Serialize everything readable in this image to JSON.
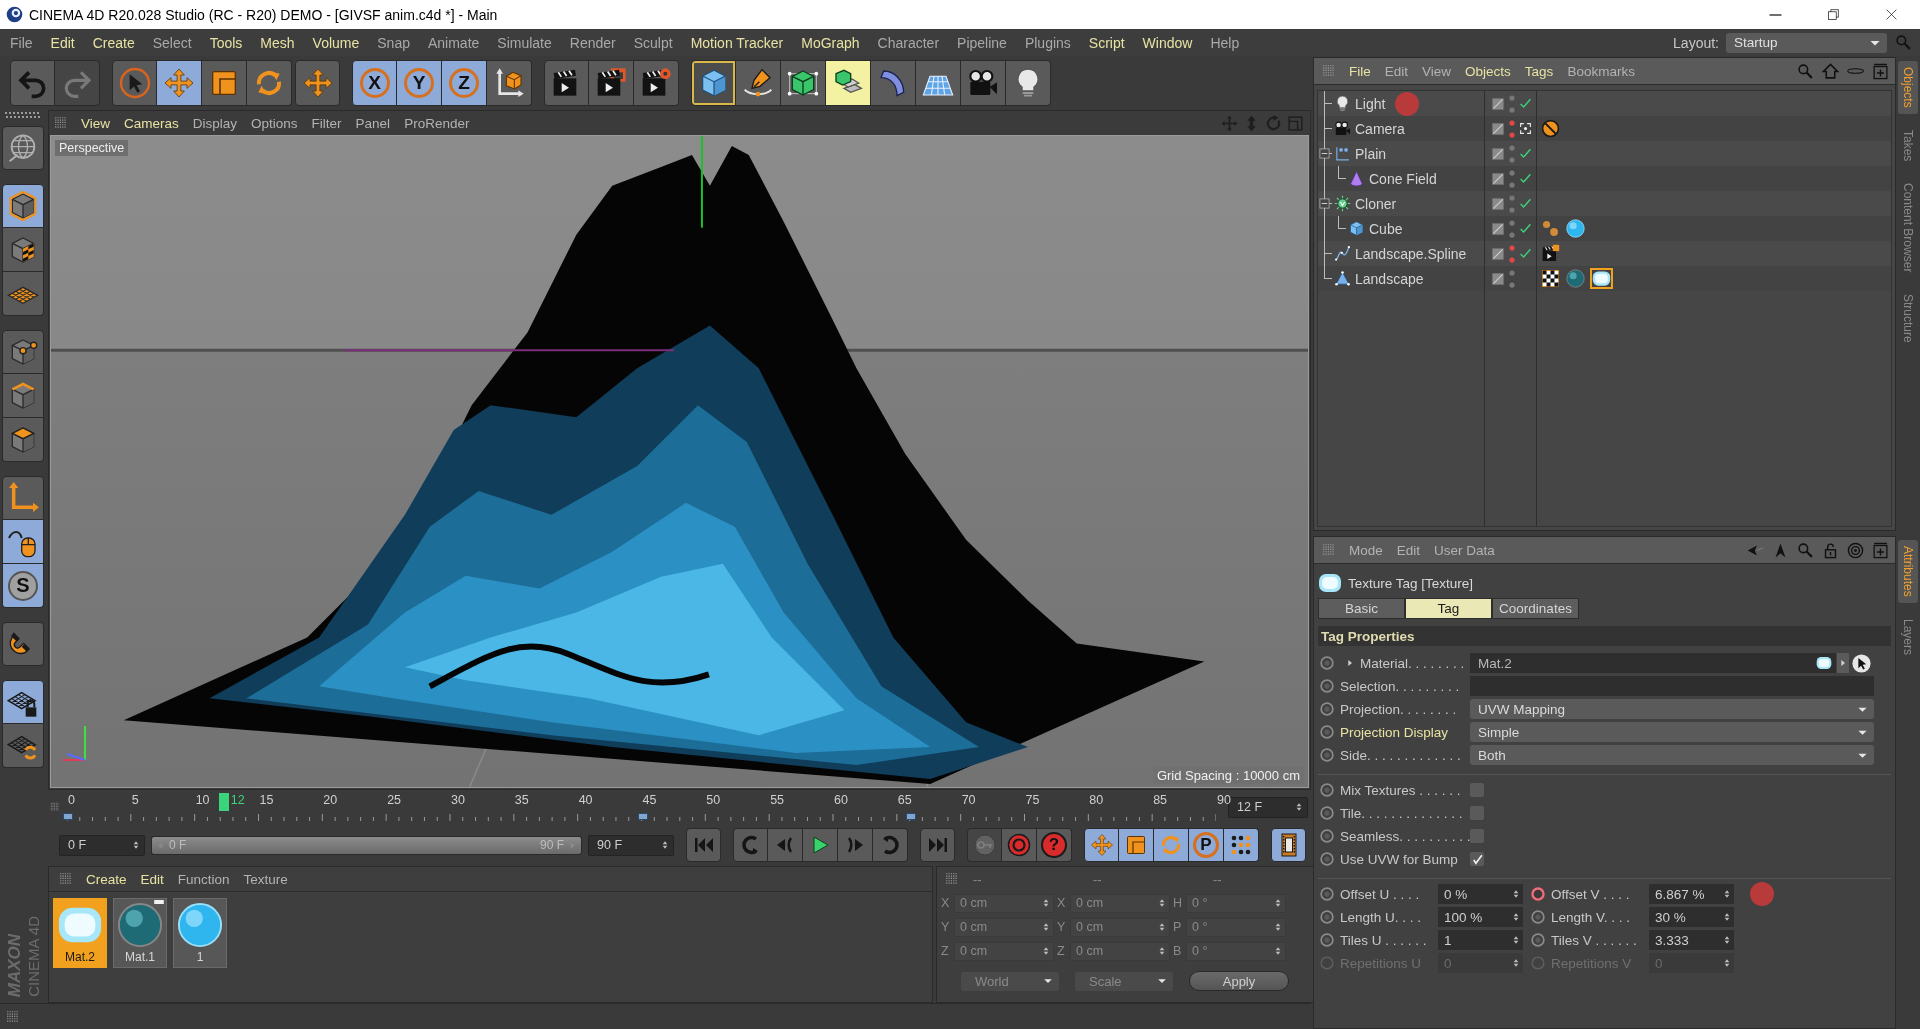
{
  "window": {
    "title": "CINEMA 4D R20.028 Studio (RC - R20) DEMO - [GIVSF anim.c4d *] - Main"
  },
  "menu_bar": {
    "items": [
      {
        "label": "File",
        "highlighted": false
      },
      {
        "label": "Edit",
        "highlighted": true
      },
      {
        "label": "Create",
        "highlighted": true
      },
      {
        "label": "Select",
        "highlighted": false
      },
      {
        "label": "Tools",
        "highlighted": true
      },
      {
        "label": "Mesh",
        "highlighted": true
      },
      {
        "label": "Volume",
        "highlighted": true
      },
      {
        "label": "Snap",
        "highlighted": false
      },
      {
        "label": "Animate",
        "highlighted": false
      },
      {
        "label": "Simulate",
        "highlighted": false
      },
      {
        "label": "Render",
        "highlighted": false
      },
      {
        "label": "Sculpt",
        "highlighted": false
      },
      {
        "label": "Motion Tracker",
        "highlighted": true
      },
      {
        "label": "MoGraph",
        "highlighted": true
      },
      {
        "label": "Character",
        "highlighted": false
      },
      {
        "label": "Pipeline",
        "highlighted": false
      },
      {
        "label": "Plugins",
        "highlighted": false
      },
      {
        "label": "Script",
        "highlighted": true
      },
      {
        "label": "Window",
        "highlighted": true
      },
      {
        "label": "Help",
        "highlighted": false
      }
    ],
    "layout_label": "Layout:",
    "layout_value": "Startup"
  },
  "toolbar": {
    "groups": [
      [
        {
          "kind": "undo",
          "active": false,
          "disabled": false,
          "highlighted": false,
          "outlined": false
        },
        {
          "kind": "redo",
          "active": false,
          "disabled": true,
          "highlighted": false,
          "outlined": false
        }
      ],
      [
        {
          "kind": "live_select",
          "active": false,
          "disabled": false,
          "highlighted": false,
          "outlined": false
        },
        {
          "kind": "move",
          "active": true,
          "disabled": false,
          "highlighted": false,
          "outlined": false
        },
        {
          "kind": "scale",
          "active": false,
          "disabled": false,
          "highlighted": false,
          "outlined": false
        },
        {
          "kind": "rotate",
          "active": false,
          "disabled": false,
          "highlighted": false,
          "outlined": false
        }
      ],
      [
        {
          "kind": "move",
          "active": false,
          "disabled": false,
          "highlighted": false,
          "outlined": false
        }
      ],
      [
        {
          "kind": "axis_letter",
          "label": "X",
          "active": true,
          "disabled": false,
          "highlighted": false,
          "outlined": false
        },
        {
          "kind": "axis_letter",
          "label": "Y",
          "active": true,
          "disabled": false,
          "highlighted": false,
          "outlined": false
        },
        {
          "kind": "axis_letter",
          "label": "Z",
          "active": true,
          "disabled": false,
          "highlighted": false,
          "outlined": false
        },
        {
          "kind": "coord_system",
          "active": false,
          "disabled": false,
          "highlighted": false,
          "outlined": false
        }
      ],
      [
        {
          "kind": "render_view",
          "active": false,
          "disabled": false,
          "highlighted": false,
          "outlined": false
        },
        {
          "kind": "render_viewer",
          "active": false,
          "disabled": false,
          "highlighted": false,
          "outlined": false
        },
        {
          "kind": "render_settings",
          "active": false,
          "disabled": false,
          "highlighted": false,
          "outlined": false
        }
      ],
      [
        {
          "kind": "cube",
          "active": false,
          "disabled": false,
          "highlighted": false,
          "outlined": true
        },
        {
          "kind": "pen",
          "active": false,
          "disabled": false,
          "highlighted": false,
          "outlined": false
        },
        {
          "kind": "subdivision",
          "active": false,
          "disabled": false,
          "highlighted": false,
          "outlined": false
        },
        {
          "kind": "cloner",
          "active": false,
          "disabled": false,
          "highlighted": true,
          "outlined": false
        },
        {
          "kind": "deformer",
          "active": false,
          "disabled": false,
          "highlighted": false,
          "outlined": false
        },
        {
          "kind": "floor",
          "active": false,
          "disabled": false,
          "highlighted": false,
          "outlined": false
        },
        {
          "kind": "camera",
          "active": false,
          "disabled": false,
          "highlighted": false,
          "outlined": false
        },
        {
          "kind": "light",
          "active": false,
          "disabled": false,
          "highlighted": false,
          "outlined": false
        }
      ]
    ]
  },
  "left_tools": {
    "groups": [
      [
        {
          "kind": "make_editable",
          "active": false
        }
      ],
      [
        {
          "kind": "model",
          "active": true
        },
        {
          "kind": "texture",
          "active": false
        },
        {
          "kind": "workplane",
          "active": false
        }
      ],
      [
        {
          "kind": "points",
          "active": false
        },
        {
          "kind": "edges",
          "active": false
        },
        {
          "kind": "polygons",
          "active": false
        }
      ],
      [
        {
          "kind": "axis",
          "active": false
        },
        {
          "kind": "tweak",
          "active": true
        },
        {
          "kind": "solo_letter",
          "label": "S",
          "active": true
        }
      ],
      [
        {
          "kind": "magnet",
          "active": false
        }
      ],
      [
        {
          "kind": "grid_lock",
          "active": true
        },
        {
          "kind": "grid_align",
          "active": false
        }
      ]
    ]
  },
  "viewport": {
    "menu": [
      {
        "label": "View",
        "highlighted": true
      },
      {
        "label": "Cameras",
        "highlighted": true
      },
      {
        "label": "Display",
        "highlighted": false
      },
      {
        "label": "Options",
        "highlighted": false
      },
      {
        "label": "Filter",
        "highlighted": false
      },
      {
        "label": "Panel",
        "highlighted": false
      },
      {
        "label": "ProRender",
        "highlighted": false
      }
    ],
    "camera": "Perspective",
    "grid_spacing": "Grid Spacing : 10000 cm"
  },
  "timeline": {
    "ticks": [
      "0",
      "5",
      "10",
      "15",
      "20",
      "25",
      "30",
      "35",
      "40",
      "45",
      "50",
      "55",
      "60",
      "65",
      "70",
      "75",
      "80",
      "85",
      "90"
    ],
    "current": {
      "label": "12",
      "level": 0.133
    },
    "keys": [
      {
        "level": 0
      },
      {
        "level": 0.5
      },
      {
        "level": 0.734
      }
    ],
    "frame_field": "12 F"
  },
  "playback": {
    "start_field": "0 F",
    "range": {
      "start": "0 F",
      "end": "90 F",
      "level": 1
    },
    "end_field": "90 F",
    "groups": [
      [
        {
          "kind": "go_start",
          "active": false,
          "disabled": false
        }
      ],
      [
        {
          "kind": "prev_key",
          "active": false,
          "disabled": false
        },
        {
          "kind": "prev_frame",
          "active": false,
          "disabled": false
        },
        {
          "kind": "play",
          "active": false,
          "disabled": false
        },
        {
          "kind": "next_frame",
          "active": false,
          "disabled": false
        },
        {
          "kind": "next_key",
          "active": false,
          "disabled": false
        }
      ],
      [
        {
          "kind": "go_end",
          "active": false,
          "disabled": false
        }
      ],
      [
        {
          "kind": "key",
          "active": false,
          "disabled": true
        },
        {
          "kind": "record",
          "active": false,
          "disabled": false
        },
        {
          "kind": "help_letter",
          "label": "?",
          "active": false,
          "disabled": false
        }
      ],
      [
        {
          "kind": "move",
          "active": true,
          "disabled": false
        },
        {
          "kind": "scale",
          "active": true,
          "disabled": false
        },
        {
          "kind": "rotate",
          "active": true,
          "disabled": false
        },
        {
          "kind": "param_letter",
          "label": "P",
          "active": true,
          "disabled": false
        },
        {
          "kind": "dots",
          "active": true,
          "disabled": false
        }
      ],
      [
        {
          "kind": "film",
          "active": true,
          "disabled": false
        }
      ]
    ]
  },
  "logo": {
    "brand": "MAXON",
    "product": "CINEMA 4D"
  },
  "materials": {
    "menu": [
      {
        "label": "Create",
        "highlighted": true
      },
      {
        "label": "Edit",
        "highlighted": true
      },
      {
        "label": "Function",
        "highlighted": false
      },
      {
        "label": "Texture",
        "highlighted": false
      }
    ],
    "items": [
      {
        "name": "Mat.2",
        "kind": "glow",
        "selected": true,
        "flagged": false
      },
      {
        "name": "Mat.1",
        "kind": "sphere_teal",
        "selected": false,
        "flagged": true
      },
      {
        "name": "1",
        "kind": "sphere_cyan",
        "selected": false,
        "flagged": false
      }
    ]
  },
  "coordinates": {
    "disabled": true,
    "headers": [
      "--",
      "--",
      "--"
    ],
    "rows": [
      [
        {
          "axis": "X",
          "value": "0 cm"
        },
        {
          "axis": "X",
          "value": "0 cm"
        },
        {
          "axis": "H",
          "value": "0 °"
        }
      ],
      [
        {
          "axis": "Y",
          "value": "0 cm"
        },
        {
          "axis": "Y",
          "value": "0 cm"
        },
        {
          "axis": "P",
          "value": "0 °"
        }
      ],
      [
        {
          "axis": "Z",
          "value": "0 cm"
        },
        {
          "axis": "Z",
          "value": "0 cm"
        },
        {
          "axis": "B",
          "value": "0 °"
        }
      ]
    ],
    "space": "World",
    "mode": "Scale",
    "apply": "Apply"
  },
  "objects_manager": {
    "menu": [
      {
        "label": "File",
        "highlighted": true
      },
      {
        "label": "Edit",
        "highlighted": false
      },
      {
        "label": "View",
        "highlighted": false
      },
      {
        "label": "Objects",
        "highlighted": true
      },
      {
        "label": "Tags",
        "highlighted": true
      },
      {
        "label": "Bookmarks",
        "highlighted": false
      }
    ],
    "objects": [
      {
        "name": "Light",
        "kind": "light",
        "hidden": false,
        "enabled": true,
        "camera_active": false,
        "marker": true
      },
      {
        "name": "Camera",
        "kind": "camera",
        "hidden": true,
        "enabled": false,
        "camera_active": true,
        "marker": false,
        "tags": [
          {
            "kind": "protection",
            "selected": false
          }
        ]
      },
      {
        "name": "Plain",
        "kind": "plain",
        "hidden": false,
        "enabled": true,
        "camera_active": false,
        "marker": false,
        "expanded": true,
        "children": [
          {
            "name": "Cone Field",
            "kind": "cone",
            "hidden": false,
            "enabled": true,
            "camera_active": false,
            "marker": false
          }
        ]
      },
      {
        "name": "Cloner",
        "kind": "cloner_obj",
        "hidden": false,
        "enabled": true,
        "camera_active": false,
        "marker": false,
        "expanded": true,
        "children": [
          {
            "name": "Cube",
            "kind": "cube",
            "hidden": false,
            "enabled": true,
            "camera_active": false,
            "marker": false,
            "tags": [
              {
                "kind": "mograph",
                "selected": false
              },
              {
                "kind": "sphere_cyan",
                "selected": false
              }
            ]
          }
        ]
      },
      {
        "name": "Landscape.Spline",
        "kind": "spline",
        "hidden": true,
        "enabled": true,
        "camera_active": false,
        "marker": false,
        "tags": [
          {
            "kind": "vibrate",
            "selected": false
          }
        ]
      },
      {
        "name": "Landscape",
        "kind": "landscape",
        "hidden": false,
        "enabled": false,
        "camera_active": false,
        "marker": false,
        "tags": [
          {
            "kind": "checker",
            "selected": false
          },
          {
            "kind": "sphere_teal",
            "selected": false
          },
          {
            "kind": "glow",
            "selected": true
          }
        ]
      }
    ]
  },
  "side_tabs": {
    "upper": [
      {
        "label": "Objects",
        "selected": true
      },
      {
        "label": "Takes",
        "selected": false
      },
      {
        "label": "Content Browser",
        "selected": false
      },
      {
        "label": "Structure",
        "selected": false
      }
    ],
    "lower": [
      {
        "label": "Attributes",
        "selected": true
      },
      {
        "label": "Layers",
        "selected": false
      }
    ]
  },
  "attributes": {
    "menu": [
      {
        "label": "Mode",
        "highlighted": false
      },
      {
        "label": "Edit",
        "highlighted": false
      },
      {
        "label": "User Data",
        "highlighted": false
      }
    ],
    "title": "Texture Tag [Texture]",
    "tabs": [
      {
        "label": "Basic",
        "selected": false
      },
      {
        "label": "Tag",
        "selected": true
      },
      {
        "label": "Coordinates",
        "selected": false
      }
    ],
    "section": "Tag Properties",
    "groups": [
      [
        {
          "kind": "link",
          "label": "Material. . . . . . . .",
          "value": "Mat.2",
          "highlighted": false
        },
        {
          "kind": "text",
          "label": "Selection. . . . . . . . .",
          "highlighted": false
        },
        {
          "kind": "dropdown",
          "label": "Projection. . . . . . . .",
          "value": "UVW Mapping",
          "highlighted": false
        },
        {
          "kind": "dropdown",
          "label": "Projection Display",
          "value": "Simple",
          "highlighted": true
        },
        {
          "kind": "dropdown",
          "label": "Side. . . . . . . . . . . . .",
          "value": "Both",
          "highlighted": false
        }
      ],
      [
        {
          "kind": "checkbox",
          "label": "Mix Textures . . . . . .",
          "checked": false
        },
        {
          "kind": "checkbox",
          "label": "Tile. . . . . . . . . . . . . .",
          "checked": false
        },
        {
          "kind": "checkbox",
          "label": "Seamless. . . . . . . . . .",
          "checked": false
        },
        {
          "kind": "checkbox",
          "label": "Use UVW for Bump",
          "checked": true
        }
      ],
      [
        {
          "kind": "pair",
          "left": {
            "label": "Offset U . . . .",
            "value": "0 %",
            "animated": false,
            "disabled": false,
            "marker": false
          },
          "right": {
            "label": "Offset V . . . .",
            "value": "6.867 %",
            "animated": true,
            "disabled": false,
            "marker": true
          }
        },
        {
          "kind": "pair",
          "left": {
            "label": "Length U. . . .",
            "value": "100 %",
            "animated": false,
            "disabled": false,
            "marker": false
          },
          "right": {
            "label": "Length V. . . .",
            "value": "30 %",
            "animated": false,
            "disabled": false,
            "marker": false
          }
        },
        {
          "kind": "pair",
          "left": {
            "label": "Tiles U . . . . . .",
            "value": "1",
            "animated": false,
            "disabled": false,
            "marker": false
          },
          "right": {
            "label": "Tiles V . . . . . .",
            "value": "3.333",
            "animated": false,
            "disabled": false,
            "marker": false
          }
        },
        {
          "kind": "pair",
          "left": {
            "label": "Repetitions U",
            "value": "0",
            "animated": false,
            "disabled": true,
            "marker": false
          },
          "right": {
            "label": "Repetitions V",
            "value": "0",
            "animated": false,
            "disabled": true,
            "marker": false
          }
        }
      ]
    ]
  }
}
